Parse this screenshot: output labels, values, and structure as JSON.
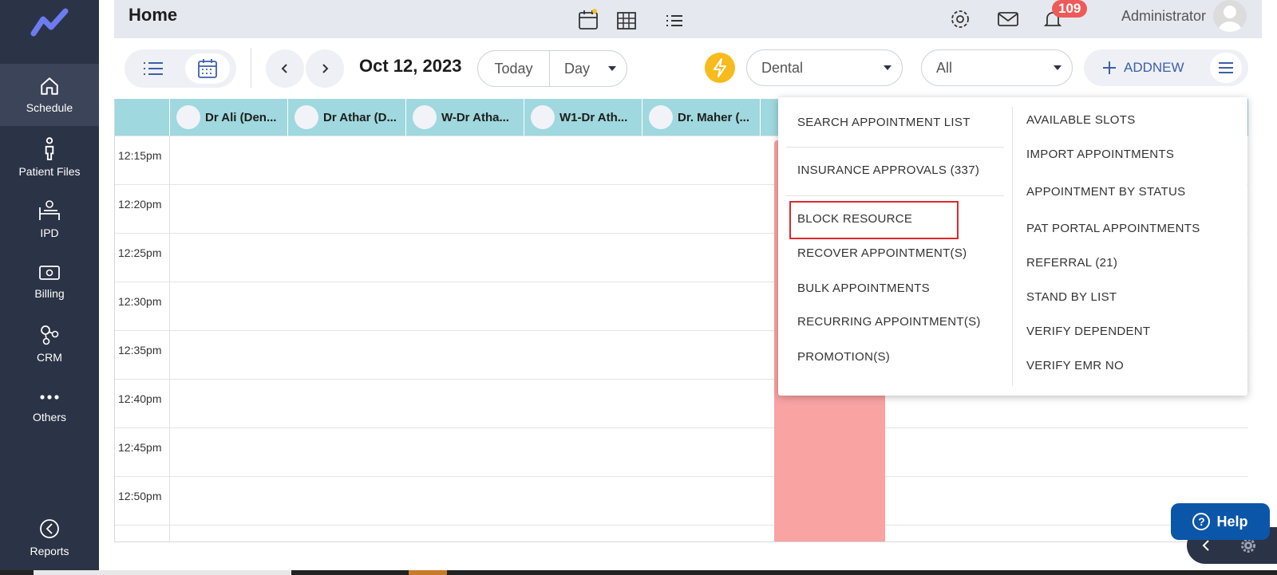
{
  "sidebar": {
    "items": [
      {
        "label": "Schedule"
      },
      {
        "label": "Patient Files"
      },
      {
        "label": "IPD"
      },
      {
        "label": "Billing"
      },
      {
        "label": "CRM"
      },
      {
        "label": "Others"
      },
      {
        "label": "Reports"
      }
    ]
  },
  "header": {
    "title": "Home",
    "notification_count": "109",
    "user_name": "Administrator"
  },
  "toolbar": {
    "date": "Oct 12, 2023",
    "today_label": "Today",
    "view_label": "Day",
    "department": "Dental",
    "filter": "All",
    "addnew_label": "ADDNEW"
  },
  "resources": [
    "Dr Ali (Den...",
    "Dr Athar (D...",
    "W-Dr Atha...",
    "W1-Dr Ath...",
    "Dr. Maher (..."
  ],
  "time_slots": [
    "12:15pm",
    "12:20pm",
    "12:25pm",
    "12:30pm",
    "12:35pm",
    "12:40pm",
    "12:45pm",
    "12:50pm"
  ],
  "dropdown": {
    "left": [
      "SEARCH APPOINTMENT LIST",
      "INSURANCE APPROVALS (337)",
      "BLOCK RESOURCE",
      "RECOVER APPOINTMENT(S)",
      "BULK APPOINTMENTS",
      "RECURRING APPOINTMENT(S)",
      "PROMOTION(S)"
    ],
    "right": [
      "AVAILABLE SLOTS",
      "IMPORT APPOINTMENTS",
      "APPOINTMENT BY STATUS",
      "PAT PORTAL APPOINTMENTS",
      "REFERRAL (21)",
      "STAND BY LIST",
      "VERIFY DEPENDENT",
      "VERIFY EMR NO"
    ]
  },
  "help_label": "Help",
  "colors": {
    "sidebar": "#2b3346",
    "resource_header": "#9fd8de",
    "blocked": "#f9a3a3",
    "accent_yellow": "#f8bb1e",
    "highlight": "#e02828",
    "help": "#0b56a8"
  }
}
